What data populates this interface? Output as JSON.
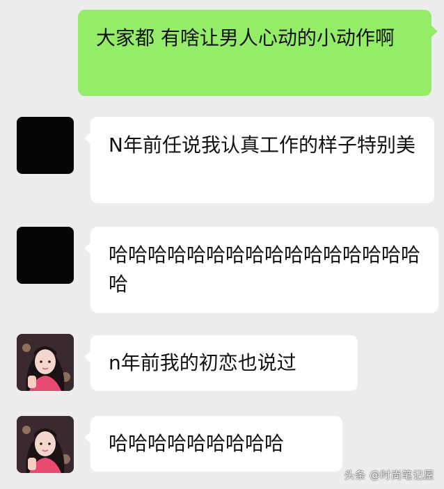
{
  "messages": [
    {
      "side": "outgoing",
      "avatar": "none",
      "text": "大家都 有啥让男人心动的小动作啊"
    },
    {
      "side": "incoming",
      "avatar": "black-square",
      "text": "N年前任说我认真工作的样子特别美"
    },
    {
      "side": "incoming",
      "avatar": "black-square",
      "text": "哈哈哈哈哈哈哈哈哈哈哈哈哈哈哈哈哈"
    },
    {
      "side": "incoming",
      "avatar": "girl-photo",
      "text": "n年前我的初恋也说过"
    },
    {
      "side": "incoming",
      "avatar": "girl-photo",
      "text": "哈哈哈哈哈哈哈哈哈"
    }
  ],
  "watermark": {
    "text": "头条 @时尚笔记屋"
  },
  "colors": {
    "background": "#ededed",
    "outgoing_bubble": "#95ec69",
    "incoming_bubble": "#ffffff",
    "text": "#111111"
  }
}
